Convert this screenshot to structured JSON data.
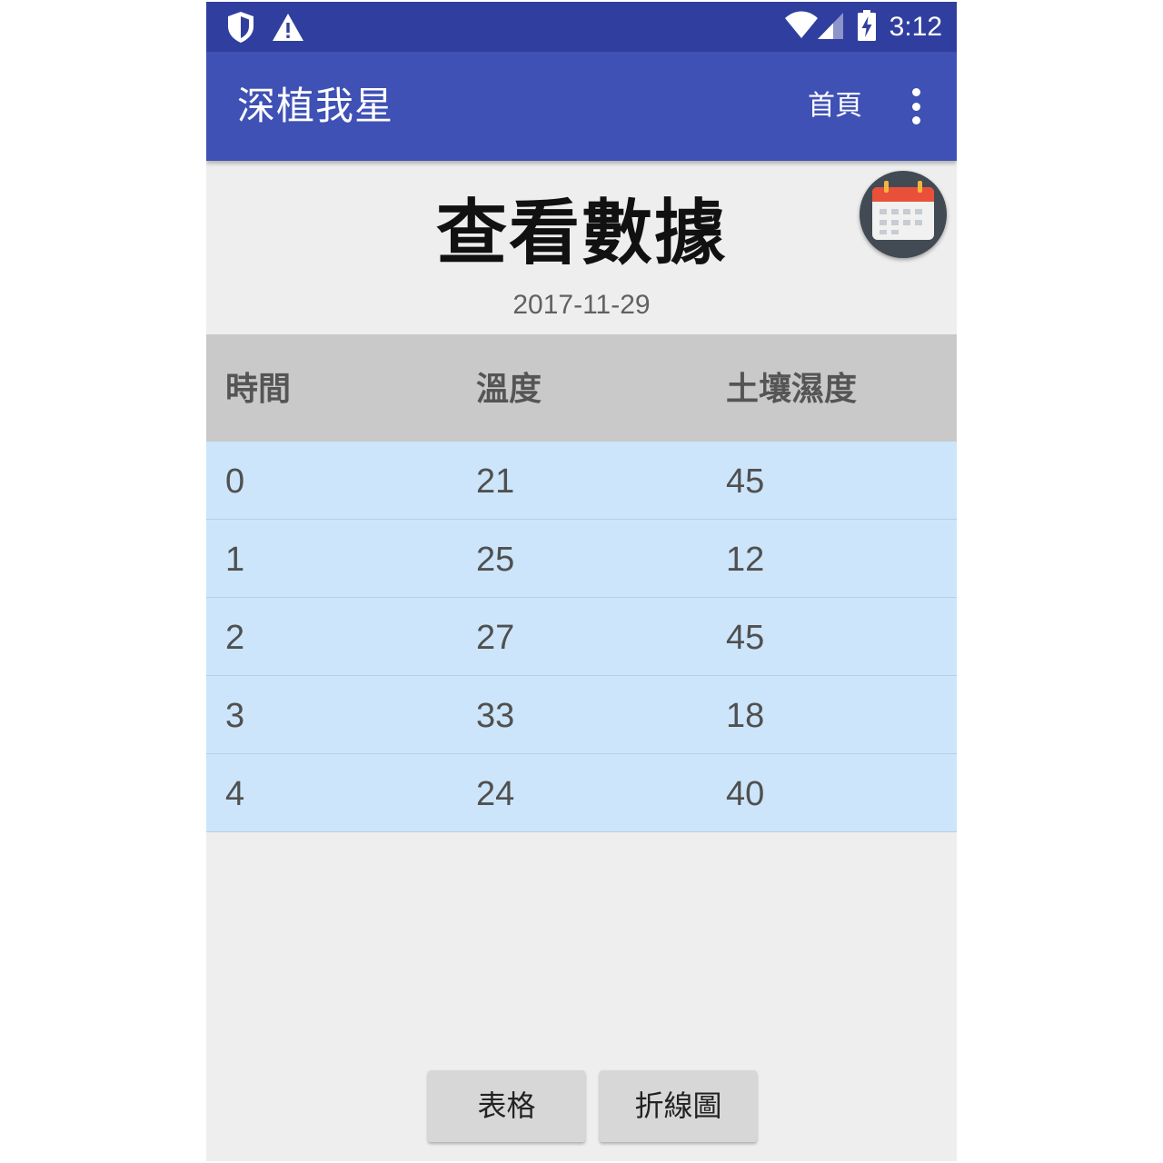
{
  "status_bar": {
    "time": "3:12",
    "left_icons": [
      "shield-icon",
      "warning-icon"
    ],
    "right_icons": [
      "wifi-icon",
      "cellular-signal-icon",
      "battery-charging-icon"
    ]
  },
  "app_bar": {
    "title": "深植我星",
    "home_label": "首頁",
    "menu_icon": "more-vertical-icon"
  },
  "page": {
    "heading": "查看數據",
    "date": "2017-11-29",
    "calendar_icon": "calendar-icon"
  },
  "table": {
    "columns": [
      "時間",
      "溫度",
      "土壤濕度"
    ],
    "rows": [
      [
        "0",
        "21",
        "45"
      ],
      [
        "1",
        "25",
        "12"
      ],
      [
        "2",
        "27",
        "45"
      ],
      [
        "3",
        "33",
        "18"
      ],
      [
        "4",
        "24",
        "40"
      ]
    ]
  },
  "buttons": {
    "table_label": "表格",
    "line_chart_label": "折線圖"
  },
  "colors": {
    "status_bar": "#303f9f",
    "app_bar": "#3f51b5",
    "header_bg": "#c9c9c9",
    "row_bg": "#cce5fa",
    "page_bg": "#eeeeee",
    "calendar_red": "#e8503a"
  }
}
